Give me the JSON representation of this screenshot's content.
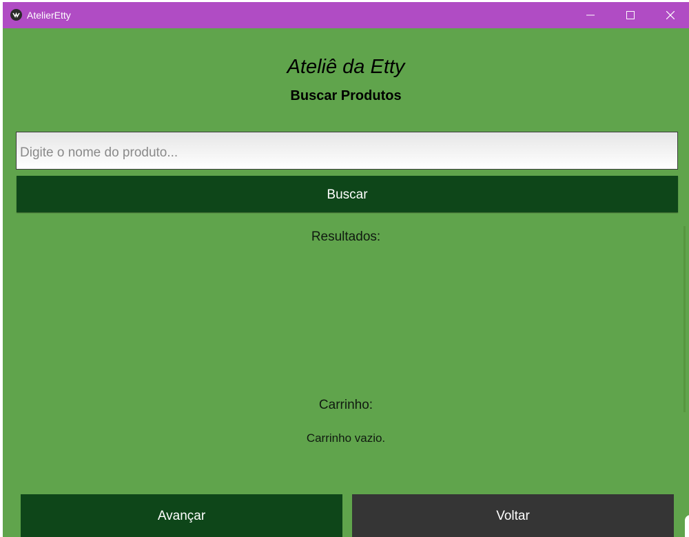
{
  "window": {
    "title": "AtelierEtty",
    "app_icon": "kivy-logo-icon"
  },
  "header": {
    "title": "Ateliê da Etty",
    "subtitle": "Buscar Produtos"
  },
  "search": {
    "placeholder": "Digite o nome do produto...",
    "value": "",
    "button_label": "Buscar"
  },
  "results": {
    "label": "Resultados:",
    "items": []
  },
  "cart": {
    "label": "Carrinho:",
    "status": "Carrinho vazio."
  },
  "footer": {
    "next_label": "Avançar",
    "back_label": "Voltar"
  },
  "colors": {
    "titlebar": "#b04cc4",
    "background": "#60a44c",
    "primary_button": "#0e4619",
    "secondary_button": "#353535"
  }
}
